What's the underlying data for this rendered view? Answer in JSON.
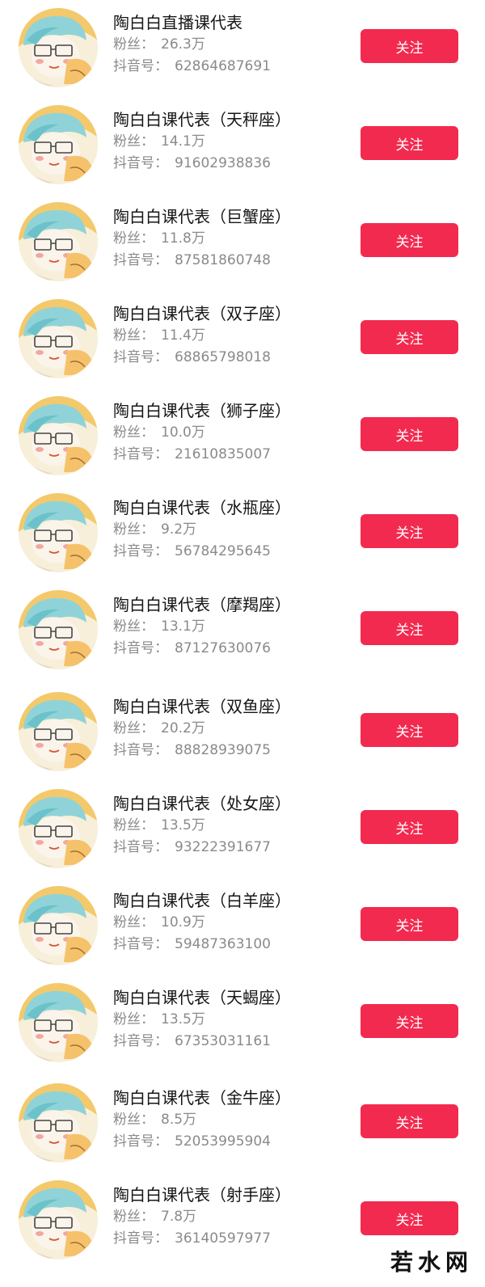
{
  "colors": {
    "follow_button": "#f22a4f",
    "secondary_text": "#8a8a8a"
  },
  "labels": {
    "fans": "粉丝：",
    "douyin_id": "抖音号："
  },
  "follow_label": "关注",
  "accounts": [
    {
      "name": "陶白白直播课代表",
      "fans": "26.3万",
      "douyin_id": "62864687691"
    },
    {
      "name": "陶白白课代表（天秤座）",
      "fans": "14.1万",
      "douyin_id": "91602938836"
    },
    {
      "name": "陶白白课代表（巨蟹座）",
      "fans": "11.8万",
      "douyin_id": "87581860748"
    },
    {
      "name": "陶白白课代表（双子座）",
      "fans": "11.4万",
      "douyin_id": "68865798018"
    },
    {
      "name": "陶白白课代表（狮子座）",
      "fans": "10.0万",
      "douyin_id": "21610835007"
    },
    {
      "name": "陶白白课代表（水瓶座）",
      "fans": "9.2万",
      "douyin_id": "56784295645"
    },
    {
      "name": "陶白白课代表（摩羯座）",
      "fans": "13.1万",
      "douyin_id": "87127630076"
    },
    {
      "name": "陶白白课代表（双鱼座）",
      "fans": "20.2万",
      "douyin_id": "88828939075"
    },
    {
      "name": "陶白白课代表（处女座）",
      "fans": "13.5万",
      "douyin_id": "93222391677"
    },
    {
      "name": "陶白白课代表（白羊座）",
      "fans": "10.9万",
      "douyin_id": "59487363100"
    },
    {
      "name": "陶白白课代表（天蝎座）",
      "fans": "13.5万",
      "douyin_id": "67353031161"
    },
    {
      "name": "陶白白课代表（金牛座）",
      "fans": "8.5万",
      "douyin_id": "52053995904"
    },
    {
      "name": "陶白白课代表（射手座）",
      "fans": "7.8万",
      "douyin_id": "36140597977"
    }
  ],
  "watermark": "若水网"
}
